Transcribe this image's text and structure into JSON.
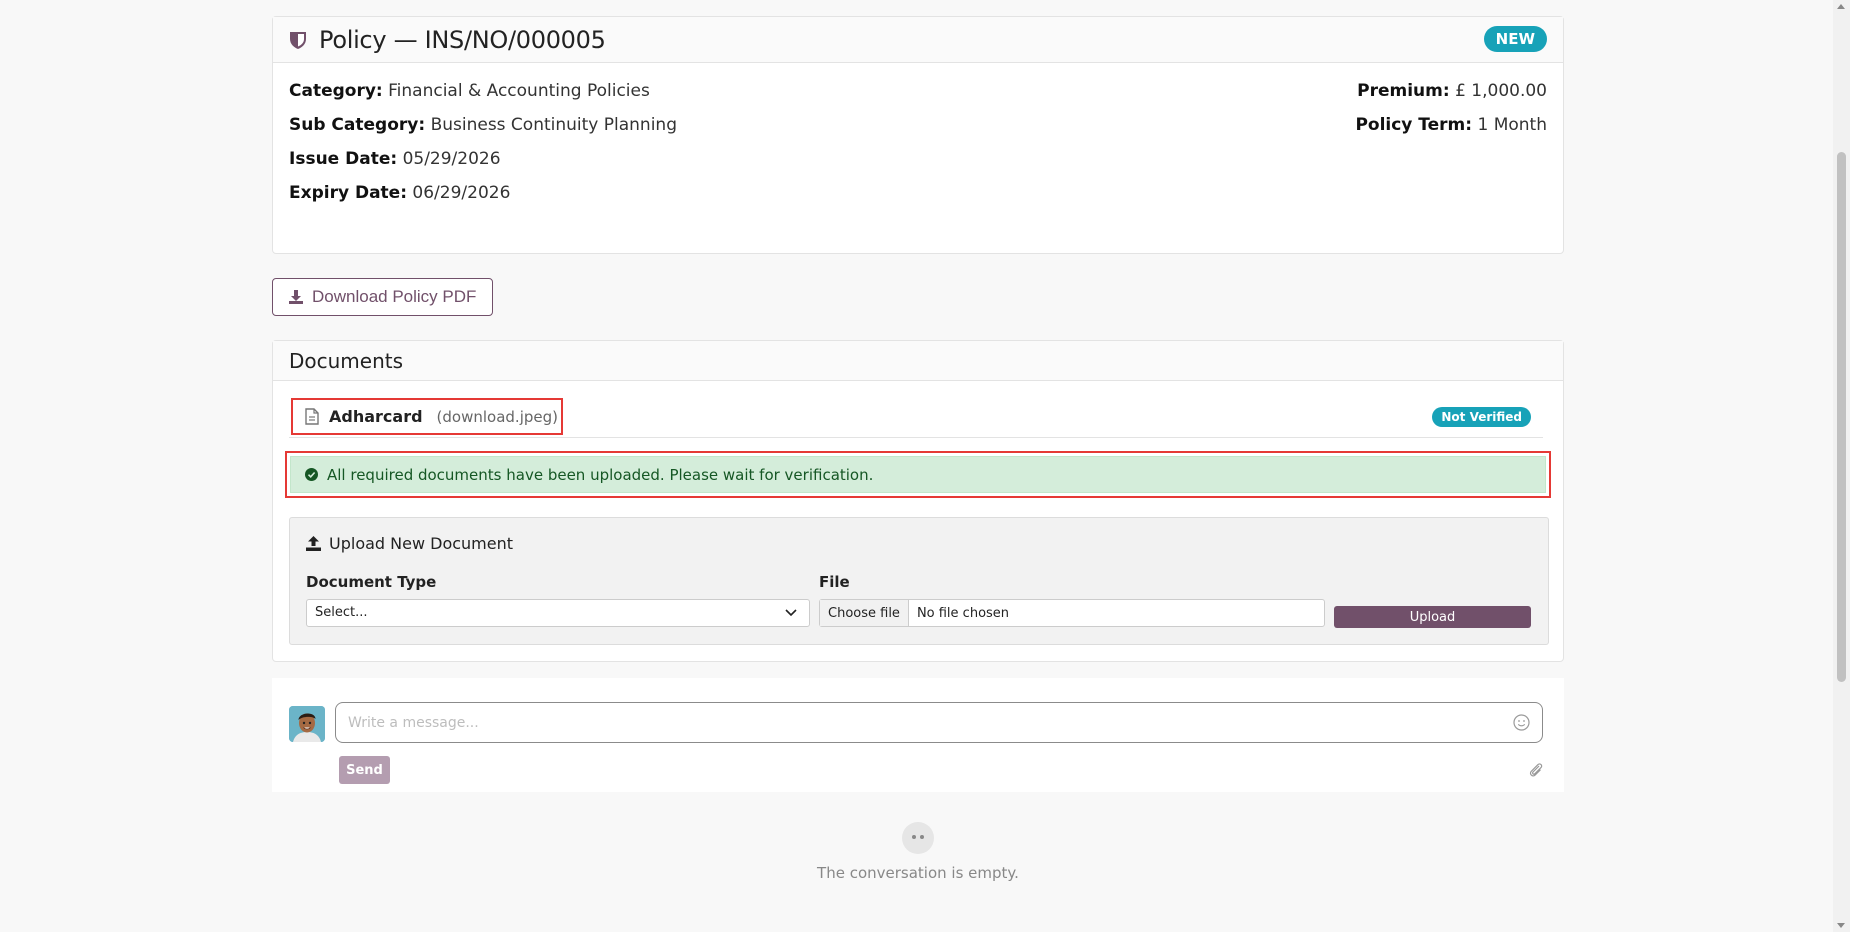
{
  "policy": {
    "title": "Policy — INS/NO/000005",
    "status": "NEW",
    "category_label": "Category:",
    "category": "Financial & Accounting Policies",
    "subcategory_label": "Sub Category:",
    "subcategory": "Business Continuity Planning",
    "issue_label": "Issue Date:",
    "issue_date": "05/29/2026",
    "expiry_label": "Expiry Date:",
    "expiry_date": "06/29/2026",
    "premium_label": "Premium:",
    "premium": "£ 1,000.00",
    "term_label": "Policy Term:",
    "term": "1 Month"
  },
  "download_label": "Download Policy PDF",
  "documents": {
    "title": "Documents",
    "items": [
      {
        "name": "Adharcard",
        "file": "(download.jpeg)",
        "status": "Not Verified"
      }
    ],
    "alert": "All required documents have been uploaded. Please wait for verification.",
    "upload": {
      "title": "Upload New Document",
      "doc_type_label": "Document Type",
      "select_value": "Select...",
      "file_label": "File",
      "choose_label": "Choose file",
      "no_file": "No file chosen",
      "button": "Upload"
    }
  },
  "chatter": {
    "placeholder": "Write a message...",
    "send": "Send",
    "empty": "The conversation is empty."
  },
  "colors": {
    "accent": "#71506a",
    "badge": "#17a2b8",
    "alert_bg": "#d4edda",
    "highlight": "#e53935"
  },
  "icons": {
    "title": "shield-icon",
    "download": "download-icon",
    "document": "file-icon",
    "alert": "check-circle-icon",
    "upload": "upload-icon",
    "select": "chevron-down-icon",
    "emoji": "smiley-icon",
    "attach": "paperclip-icon",
    "empty": "empty-face-icon"
  }
}
